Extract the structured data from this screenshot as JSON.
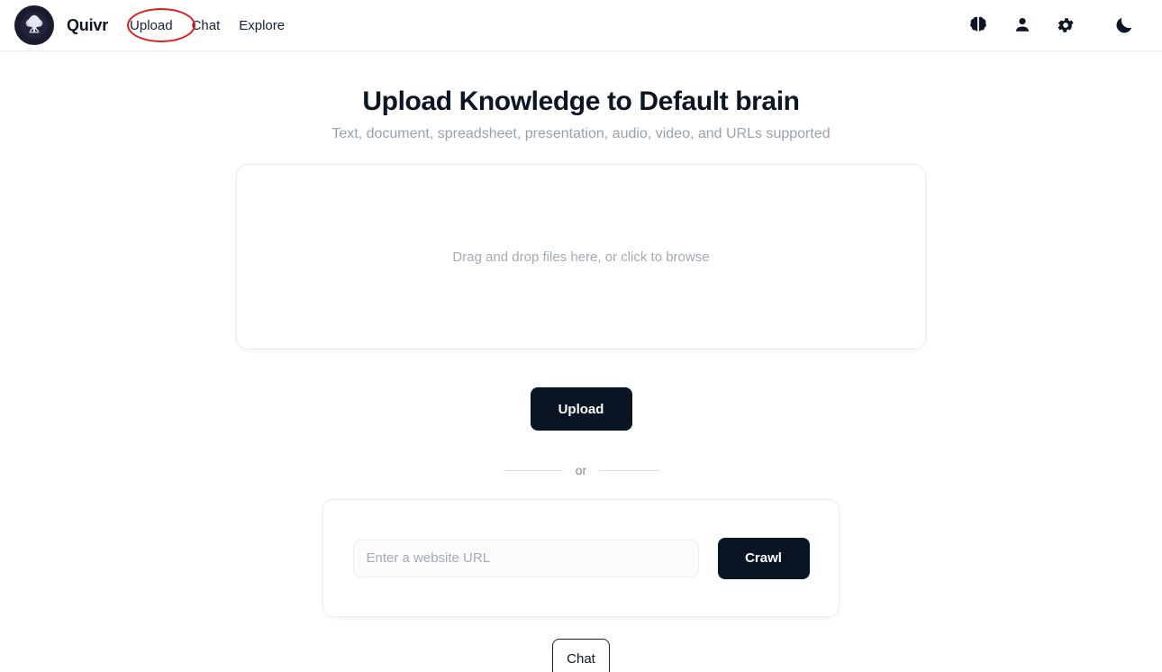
{
  "header": {
    "logo_icon": "quivr-tree-logo-icon",
    "brand_name": "Quivr",
    "nav": [
      {
        "label": "Upload",
        "name": "nav-link-upload"
      },
      {
        "label": "Chat",
        "name": "nav-link-chat"
      },
      {
        "label": "Explore",
        "name": "nav-link-explore"
      }
    ],
    "icons": [
      {
        "name": "brain-icon"
      },
      {
        "name": "person-icon"
      },
      {
        "name": "gear-icon"
      },
      {
        "name": "moon-icon"
      }
    ]
  },
  "annotation": {
    "type": "ellipse",
    "color": "#e81818",
    "targets": "Upload"
  },
  "main": {
    "title": "Upload Knowledge to Default brain",
    "subtitle": "Text, document, spreadsheet, presentation, audio, video, and URLs supported",
    "dropzone_text": "Drag and drop files here, or click to browse",
    "upload_label": "Upload",
    "or_label": "or",
    "url_placeholder": "Enter a website URL",
    "url_value": "",
    "crawl_label": "Crawl",
    "chat_label": "Chat"
  },
  "colors": {
    "accent_dark": "#0a1523",
    "annotation_red": "#e81818",
    "muted_text": "#a5aab2",
    "border": "#ececec"
  }
}
